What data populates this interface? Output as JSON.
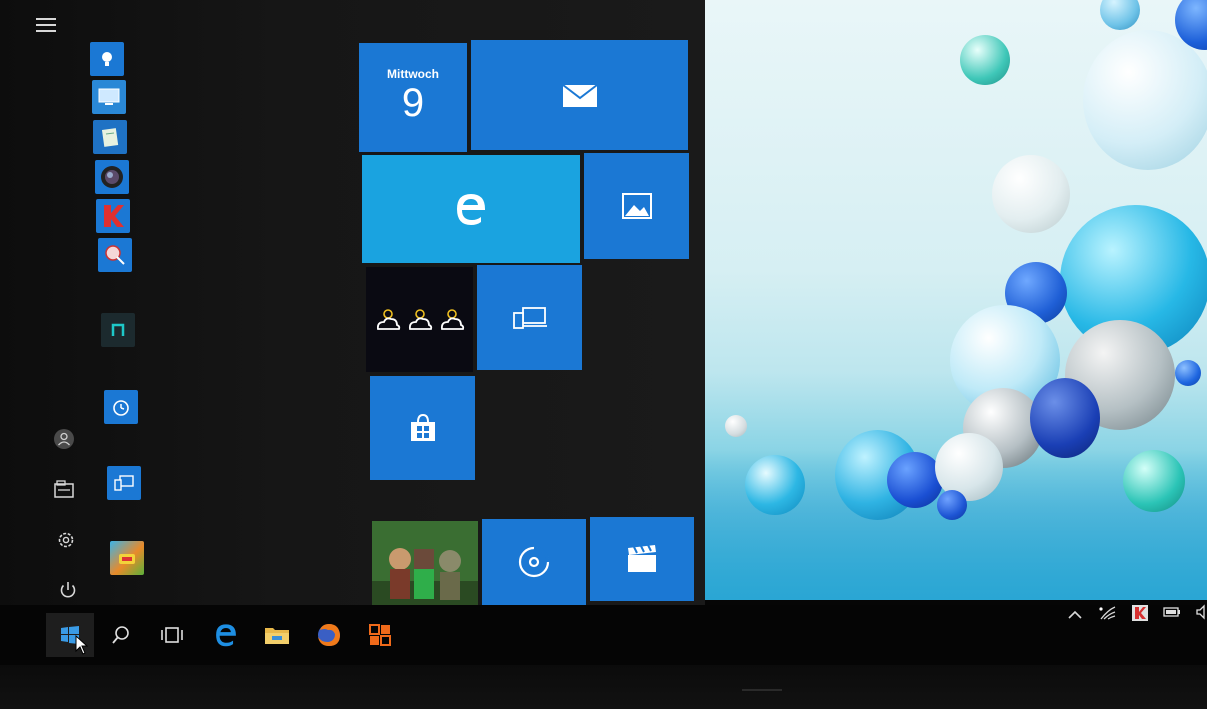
{
  "calendar_tile": {
    "day": "Mittwoch",
    "date": "9"
  },
  "colors": {
    "tile_blue": "#1b78d4",
    "edge_tile": "#1aa3e0",
    "start_bg": "#161616",
    "taskbar_bg": "#050505"
  },
  "left_rail": {
    "items": [
      {
        "name": "user-icon"
      },
      {
        "name": "file-explorer-icon"
      },
      {
        "name": "settings-gear-icon"
      },
      {
        "name": "power-icon"
      }
    ]
  },
  "tiles": [
    {
      "name": "mail-tile",
      "icon": "envelope-icon"
    },
    {
      "name": "edge-tile",
      "icon": "edge-e-icon"
    },
    {
      "name": "photos-tile",
      "icon": "photo-icon"
    },
    {
      "name": "weather-tile",
      "icon": "partly-cloudy-icon"
    },
    {
      "name": "connect-tile",
      "icon": "devices-icon"
    },
    {
      "name": "store-tile",
      "icon": "shopping-bag-icon"
    },
    {
      "name": "xbox-tile",
      "icon": "game-characters-image"
    },
    {
      "name": "groove-music-tile",
      "icon": "music-disc-icon"
    },
    {
      "name": "movies-tv-tile",
      "icon": "clapperboard-icon"
    }
  ],
  "taskbar": {
    "buttons": [
      {
        "name": "start-button",
        "icon": "windows-logo-icon"
      },
      {
        "name": "search-button",
        "icon": "search-icon"
      },
      {
        "name": "task-view-button",
        "icon": "task-view-icon"
      },
      {
        "name": "edge-taskbar-button",
        "icon": "edge-icon"
      },
      {
        "name": "file-explorer-taskbar-button",
        "icon": "folder-icon"
      },
      {
        "name": "firefox-taskbar-button",
        "icon": "firefox-icon"
      },
      {
        "name": "office-taskbar-button",
        "icon": "office-icon"
      }
    ],
    "tray": [
      "chevron-up-icon",
      "wifi-icon",
      "antivirus-icon",
      "battery-icon",
      "volume-icon"
    ]
  }
}
